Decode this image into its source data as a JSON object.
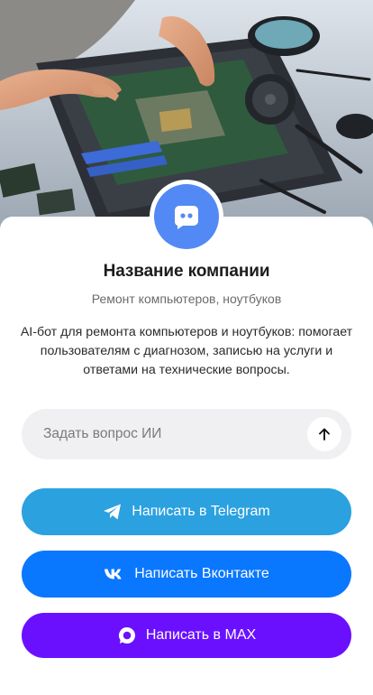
{
  "hero": {
    "icon": "laptop-repair-illustration"
  },
  "profile": {
    "avatar_icon": "chat-bubble-icon",
    "avatar_color": "#5389f5",
    "name": "Название компании",
    "subtitle": "Ремонт компьютеров, ноутбуков",
    "description": "AI-бот для ремонта компьютеров и ноутбуков: помогает пользователям с диагнозом, записью на услуги и ответами на технические вопросы."
  },
  "ask": {
    "value": "",
    "placeholder": "Задать вопрос ИИ",
    "send_icon": "arrow-up-icon"
  },
  "buttons": {
    "telegram": {
      "label": "Написать в Telegram",
      "icon": "telegram-icon",
      "color": "#2ba1e0"
    },
    "vk": {
      "label": "Написать Вконтакте",
      "icon": "vk-icon",
      "color": "#0a77ff"
    },
    "max": {
      "label": "Написать в MAX",
      "icon": "max-icon",
      "color": "#6b10ff"
    }
  }
}
